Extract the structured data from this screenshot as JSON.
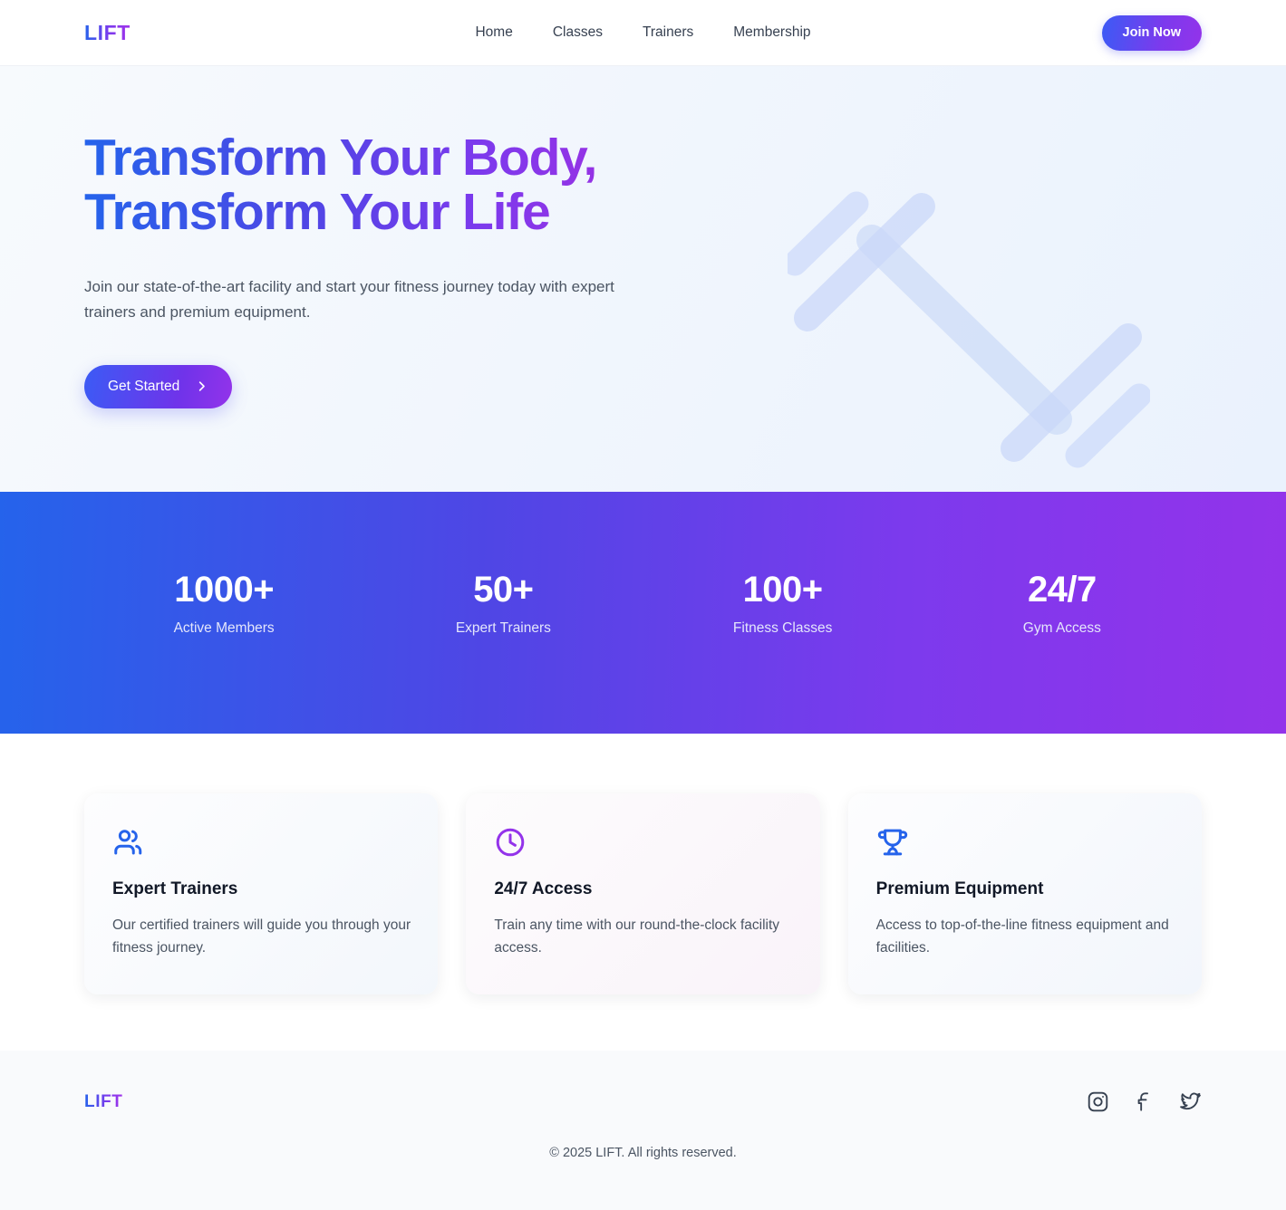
{
  "brand": {
    "name": "LIFT"
  },
  "nav": {
    "links": [
      {
        "label": "Home"
      },
      {
        "label": "Classes"
      },
      {
        "label": "Trainers"
      },
      {
        "label": "Membership"
      }
    ],
    "cta_label": "Join Now"
  },
  "hero": {
    "title_line1": "Transform Your Body,",
    "title_line2": "Transform Your Life",
    "subtitle": "Join our state-of-the-art facility and start your fitness journey today with expert trainers and premium equipment.",
    "cta_label": "Get Started",
    "decoration_icon": "dumbbell-icon"
  },
  "stats": [
    {
      "value": "1000+",
      "label": "Active Members"
    },
    {
      "value": "50+",
      "label": "Expert Trainers"
    },
    {
      "value": "100+",
      "label": "Fitness Classes"
    },
    {
      "value": "24/7",
      "label": "Gym Access"
    }
  ],
  "features": [
    {
      "icon": "users-icon",
      "icon_color": "#2563eb",
      "title": "Expert Trainers",
      "description": "Our certified trainers will guide you through your fitness journey."
    },
    {
      "icon": "clock-icon",
      "icon_color": "#9333ea",
      "title": "24/7 Access",
      "description": "Train any time with our round-the-clock facility access."
    },
    {
      "icon": "trophy-icon",
      "icon_color": "#2563eb",
      "title": "Premium Equipment",
      "description": "Access to top-of-the-line fitness equipment and facilities."
    }
  ],
  "footer": {
    "brand": "LIFT",
    "socials": [
      {
        "name": "instagram-icon"
      },
      {
        "name": "facebook-icon"
      },
      {
        "name": "twitter-icon"
      }
    ],
    "copyright": "© 2025 LIFT. All rights reserved."
  },
  "colors": {
    "brand_blue": "#2563eb",
    "brand_purple": "#9333ea",
    "hero_bg": "#f1f6fd",
    "text_dark": "#111827",
    "text_muted": "#4b5563"
  }
}
